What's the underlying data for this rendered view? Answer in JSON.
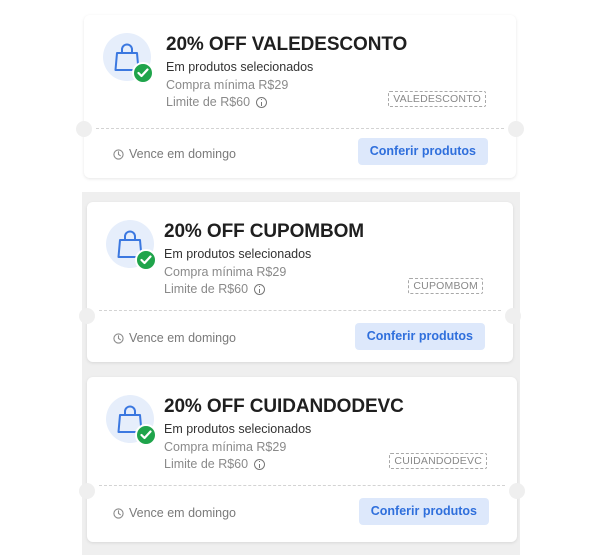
{
  "coupons": [
    {
      "title": "20% OFF VALEDESCONTO",
      "subtitle": "Em produtos selecionados",
      "min_purchase": "Compra mínima R$29",
      "limit": "Limite de R$60",
      "code": "VALEDESCONTO",
      "expires": "Vence em domingo",
      "cta": "Conferir produtos"
    },
    {
      "title": "20% OFF CUPOMBOM",
      "subtitle": "Em produtos selecionados",
      "min_purchase": "Compra mínima R$29",
      "limit": "Limite de R$60",
      "code": "CUPOMBOM",
      "expires": "Vence em domingo",
      "cta": "Conferir produtos"
    },
    {
      "title": "20% OFF CUIDANDODEVC",
      "subtitle": "Em produtos selecionados",
      "min_purchase": "Compra mínima R$29",
      "limit": "Limite de R$60",
      "code": "CUIDANDODEVC",
      "expires": "Vence em domingo",
      "cta": "Conferir produtos"
    }
  ],
  "icons": {
    "coupon": "shopping-bag-icon",
    "badge": "check-icon",
    "info": "info-icon",
    "expiry": "clock-icon"
  },
  "colors": {
    "accent": "#2f6fdc",
    "button_bg": "#dde8fb",
    "success": "#1fa44b",
    "icon_bg": "#e6eefb"
  }
}
